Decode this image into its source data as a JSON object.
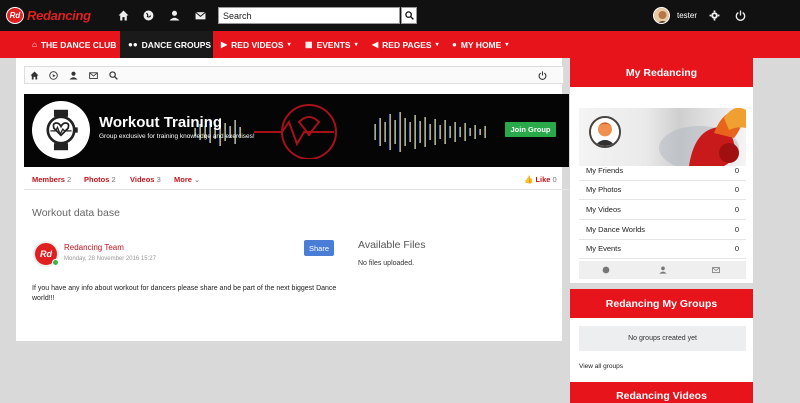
{
  "brand": {
    "badge": "Rd",
    "name": "Redancing",
    "color": "#e02020"
  },
  "topbar": {
    "search": {
      "value": "Search",
      "placeholder": "Search"
    },
    "user": {
      "name": "tester"
    },
    "icons": [
      "home-icon",
      "globe-icon",
      "user-icon",
      "mail-icon",
      "search-icon",
      "gear-icon",
      "power-icon"
    ]
  },
  "nav": {
    "items": [
      {
        "label": "THE DANCE CLUB",
        "icon": "home-icon",
        "caret": ""
      },
      {
        "label": "DANCE GROUPS",
        "icon": "users-icon",
        "caret": ""
      },
      {
        "label": "RED VIDEOS",
        "icon": "play-icon",
        "caret": "▾"
      },
      {
        "label": "EVENTS",
        "icon": "calendar-icon",
        "caret": "▾"
      },
      {
        "label": "RED PAGES",
        "icon": "megaphone-icon",
        "caret": "▾"
      },
      {
        "label": "MY HOME",
        "icon": "user-icon",
        "caret": "▾"
      }
    ],
    "accent": "#e8141c",
    "active_bg": "#1a1a1a"
  },
  "group": {
    "title": "Workout Training",
    "subtitle": "Group exclusive for training knowledge and exercises!",
    "join_label": "Join Group",
    "tabs": [
      {
        "label": "Members",
        "count": "2"
      },
      {
        "label": "Photos",
        "count": "2"
      },
      {
        "label": "Videos",
        "count": "3"
      },
      {
        "label": "More",
        "count": ""
      }
    ],
    "like": {
      "label": "Like",
      "count": "0"
    }
  },
  "content": {
    "section_title": "Workout data base",
    "post": {
      "avatar_text": "Rd",
      "author": "Redancing Team",
      "date": "Monday, 28 November 2016 15:27",
      "share_label": "Share",
      "text": "If you have any info about workout for dancers please share and be part of the next biggest Dance world!!!"
    },
    "files": {
      "title": "Available Files",
      "empty": "No files uploaded."
    }
  },
  "sidebar": {
    "profile_title": "My Redancing",
    "stats": [
      {
        "label": "My Friends",
        "value": "0"
      },
      {
        "label": "My Photos",
        "value": "0"
      },
      {
        "label": "My Videos",
        "value": "0"
      },
      {
        "label": "My Dance Worlds",
        "value": "0"
      },
      {
        "label": "My Events",
        "value": "0"
      }
    ],
    "groups_title": "Redancing My Groups",
    "groups_empty": "No groups created yet",
    "view_all": "View all groups",
    "videos_title": "Redancing Videos"
  },
  "colors": {
    "join": "#2aa94a",
    "share": "#4a7ed6",
    "link": "#c0141c"
  }
}
